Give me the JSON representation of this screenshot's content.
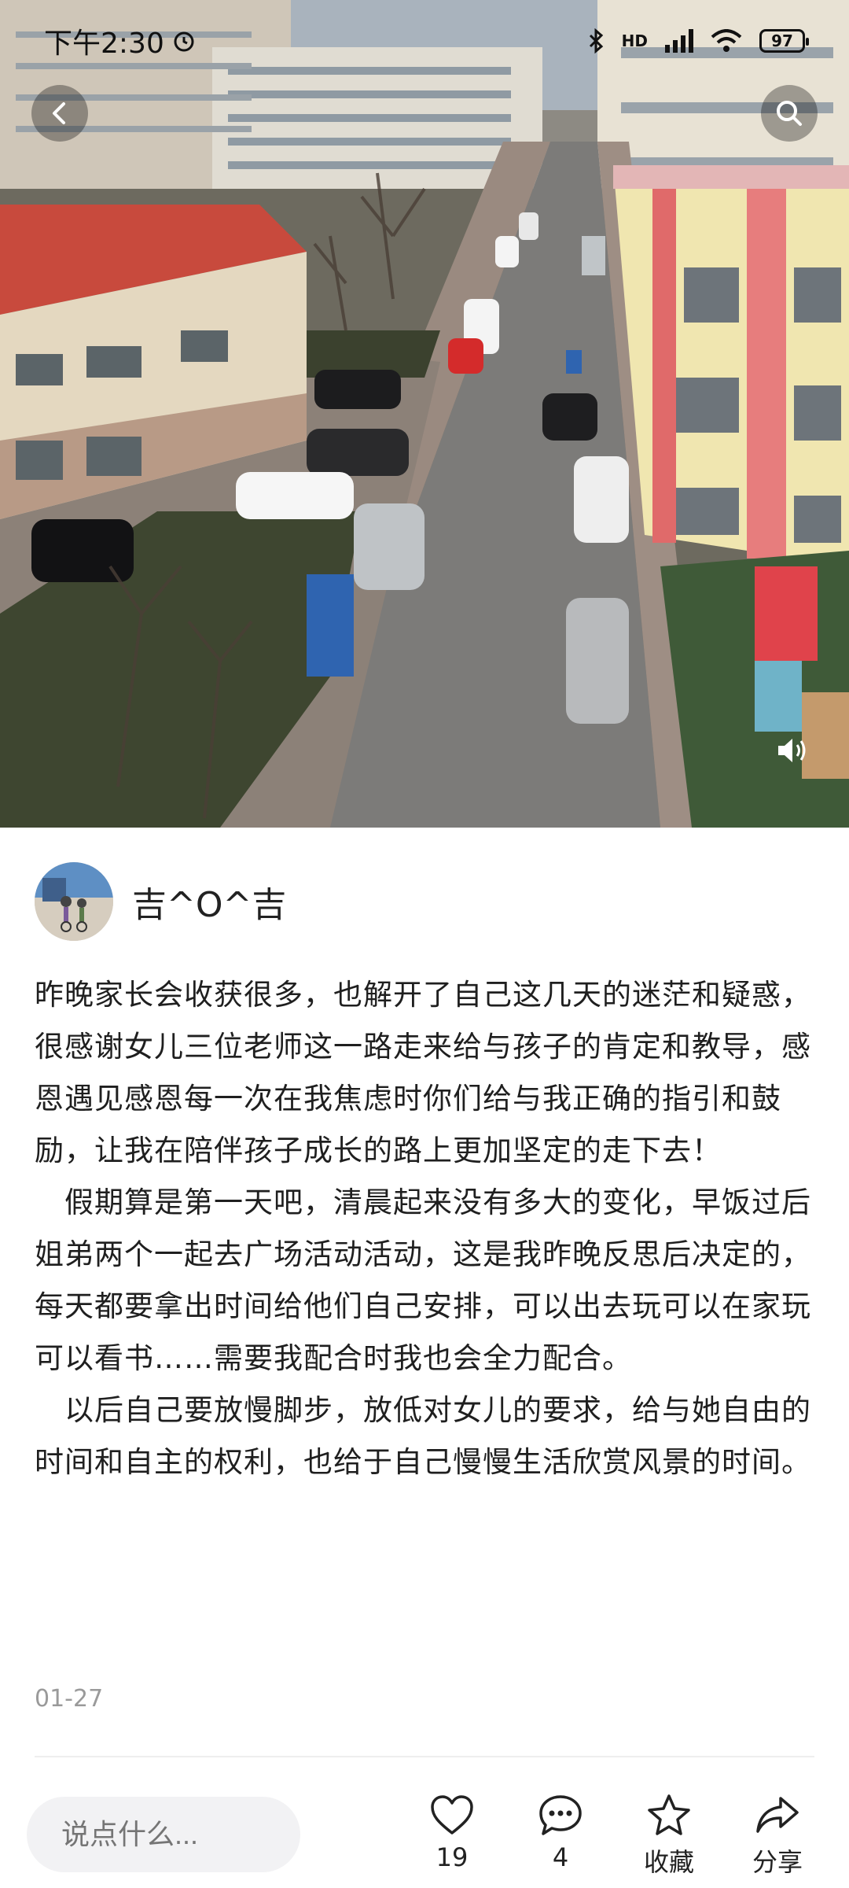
{
  "status_bar": {
    "time": "下午2:30",
    "network": "HD",
    "battery": "97"
  },
  "icons": {
    "back": "chevron-left-icon",
    "search": "search-icon",
    "sound": "speaker-icon",
    "like": "heart-icon",
    "comment": "comment-icon",
    "favorite": "star-icon",
    "share": "share-icon"
  },
  "author": {
    "name": "吉^O^吉"
  },
  "post": {
    "paragraphs": [
      "昨晚家长会收获很多，也解开了自己这几天的迷茫和疑惑，很感谢女儿三位老师这一路走来给与孩子的肯定和教导，感恩遇见感恩每一次在我焦虑时你们给与我正确的指引和鼓励，让我在陪伴孩子成长的路上更加坚定的走下去！",
      "　假期算是第一天吧，清晨起来没有多大的变化，早饭过后姐弟两个一起去广场活动活动，这是我昨晚反思后决定的，每天都要拿出时间给他们自己安排，可以出去玩可以在家玩可以看书……需要我配合时我也会全力配合。",
      "　以后自己要放慢脚步，放低对女儿的要求，给与她自由的时间和自主的权利，也给于自己慢慢生活欣赏风景的时间。"
    ],
    "date": "01-27"
  },
  "bottom_bar": {
    "comment_placeholder": "说点什么...",
    "likes": "19",
    "comments": "4",
    "favorite_label": "收藏",
    "share_label": "分享"
  },
  "colors": {
    "accent_roof": "#c84a3d",
    "icon": "#222222",
    "input_bg": "#f2f2f4"
  }
}
